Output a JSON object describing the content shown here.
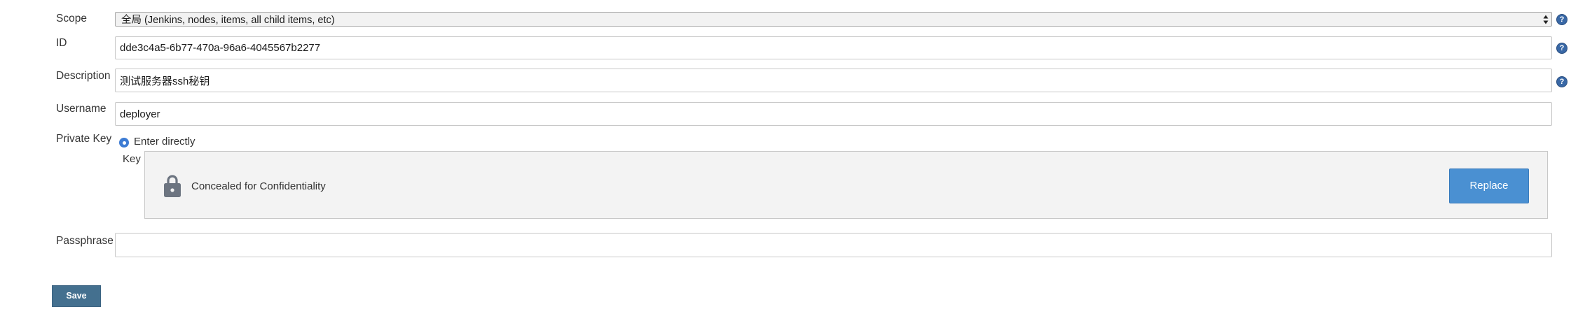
{
  "form": {
    "scope": {
      "label": "Scope",
      "selected": "全局 (Jenkins, nodes, items, all child items, etc)"
    },
    "id": {
      "label": "ID",
      "value": "dde3c4a5-6b77-470a-96a6-4045567b2277"
    },
    "description": {
      "label": "Description",
      "value": "测试服务器ssh秘钥"
    },
    "username": {
      "label": "Username",
      "value": "deployer"
    },
    "private_key": {
      "label": "Private Key",
      "option_label": "Enter directly",
      "key_label": "Key",
      "concealed_text": "Concealed for Confidentiality",
      "replace_label": "Replace"
    },
    "passphrase": {
      "label": "Passphrase",
      "value": ""
    },
    "help_glyph": "?",
    "save_label": "Save"
  },
  "colors": {
    "help_blue": "#3968a6",
    "radio_blue": "#3d7cd4",
    "replace_blue": "#4a90d2",
    "save_blue": "#44708f"
  }
}
